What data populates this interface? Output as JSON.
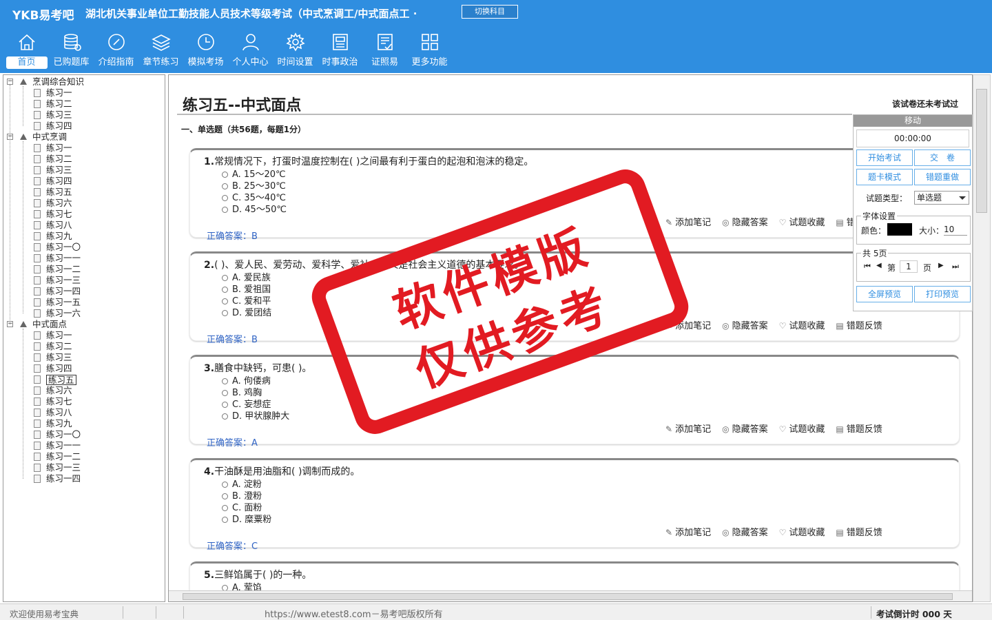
{
  "header": {
    "logo": "YKB易考吧",
    "title": "湖北机关事业单位工勤技能人员技术等级考试（中式烹调工/中式面点工 ·",
    "switch_label": "切换科目",
    "nav": [
      {
        "label": "首页",
        "icon": "home-icon"
      },
      {
        "label": "已购题库",
        "icon": "database-icon"
      },
      {
        "label": "介绍指南",
        "icon": "compass-icon"
      },
      {
        "label": "章节练习",
        "icon": "layers-icon"
      },
      {
        "label": "模拟考场",
        "icon": "clock-icon"
      },
      {
        "label": "个人中心",
        "icon": "user-icon"
      },
      {
        "label": "时间设置",
        "icon": "gear-icon"
      },
      {
        "label": "时事政治",
        "icon": "news-icon"
      },
      {
        "label": "证照易",
        "icon": "certificate-icon"
      },
      {
        "label": "更多功能",
        "icon": "grid-icon"
      }
    ]
  },
  "tree": {
    "groups": [
      {
        "label": "烹调综合知识",
        "items": [
          "练习一",
          "练习二",
          "练习三",
          "练习四"
        ]
      },
      {
        "label": "中式烹调",
        "items": [
          "练习一",
          "练习二",
          "练习三",
          "练习四",
          "练习五",
          "练习六",
          "练习七",
          "练习八",
          "练习九",
          "练习一〇",
          "练习一一",
          "练习一二",
          "练习一三",
          "练习一四",
          "练习一五",
          "练习一六"
        ]
      },
      {
        "label": "中式面点",
        "items": [
          "练习一",
          "练习二",
          "练习三",
          "练习四",
          "练习五",
          "练习六",
          "练习七",
          "练习八",
          "练习九",
          "练习一〇",
          "练习一一",
          "练习一二",
          "练习一三",
          "练习一四"
        ]
      }
    ],
    "selected": "练习五"
  },
  "exam": {
    "title": "练习五--中式面点",
    "status": "该试卷还未考试过",
    "section": "一、单选题（共56题，每题1分）",
    "answer_prefix": "正确答案：",
    "actions": [
      "添加笔记",
      "隐藏答案",
      "试题收藏",
      "错题反馈"
    ],
    "questions": [
      {
        "num": "1.",
        "text": "常规情况下，打蛋时温度控制在(   )之间最有利于蛋白的起泡和泡沫的稳定。",
        "options": [
          "A. 15～20℃",
          "B. 25～30℃",
          "C. 35～40℃",
          "D. 45～50℃"
        ],
        "answer": "B"
      },
      {
        "num": "2.",
        "text": "(   )、爱人民、爱劳动、爱科学、爱社会主义是社会主义道德的基本要求。",
        "options": [
          "A. 爱民族",
          "B. 爱祖国",
          "C. 爱和平",
          "D. 爱团结"
        ],
        "answer": "B"
      },
      {
        "num": "3.",
        "text": "膳食中缺钙，可患(   )。",
        "options": [
          "A. 佝偻病",
          "B. 鸡胸",
          "C. 妄想症",
          "D. 甲状腺肿大"
        ],
        "answer": "A"
      },
      {
        "num": "4.",
        "text": "干油酥是用油脂和(   )调制而成的。",
        "options": [
          "A. 淀粉",
          "B. 澄粉",
          "C. 面粉",
          "D. 糜粟粉"
        ],
        "answer": "C"
      },
      {
        "num": "5.",
        "text": "三鲜馅属于(   )的一种。",
        "options": [
          "A. 荤馅"
        ],
        "answer": ""
      }
    ]
  },
  "panel": {
    "move": "移动",
    "timer": "00:00:00",
    "start": "开始考试",
    "submit": "交　卷",
    "card_mode": "题卡模式",
    "redo_wrong": "错题重做",
    "qtype_label": "试题类型：",
    "qtype_value": "单选题",
    "font_legend": "字体设置",
    "color_label": "颜色：",
    "size_label": "大小：",
    "size_value": "10",
    "pages_legend": "共 5页",
    "page_prefix": "第",
    "page_value": "1",
    "page_suffix": "页",
    "fullscreen": "全屏预览",
    "print": "打印预览"
  },
  "statusbar": {
    "left": "欢迎使用易考宝典",
    "center": "https://www.etest8.com－易考吧版权所有",
    "right": "考试倒计时 000 天"
  },
  "watermark": {
    "line1": "软件模版",
    "line2": "仅供参考",
    "color": "#e21b22"
  },
  "colors": {
    "header_bg": "#2f8ee0",
    "answer": "#2f63c4"
  }
}
